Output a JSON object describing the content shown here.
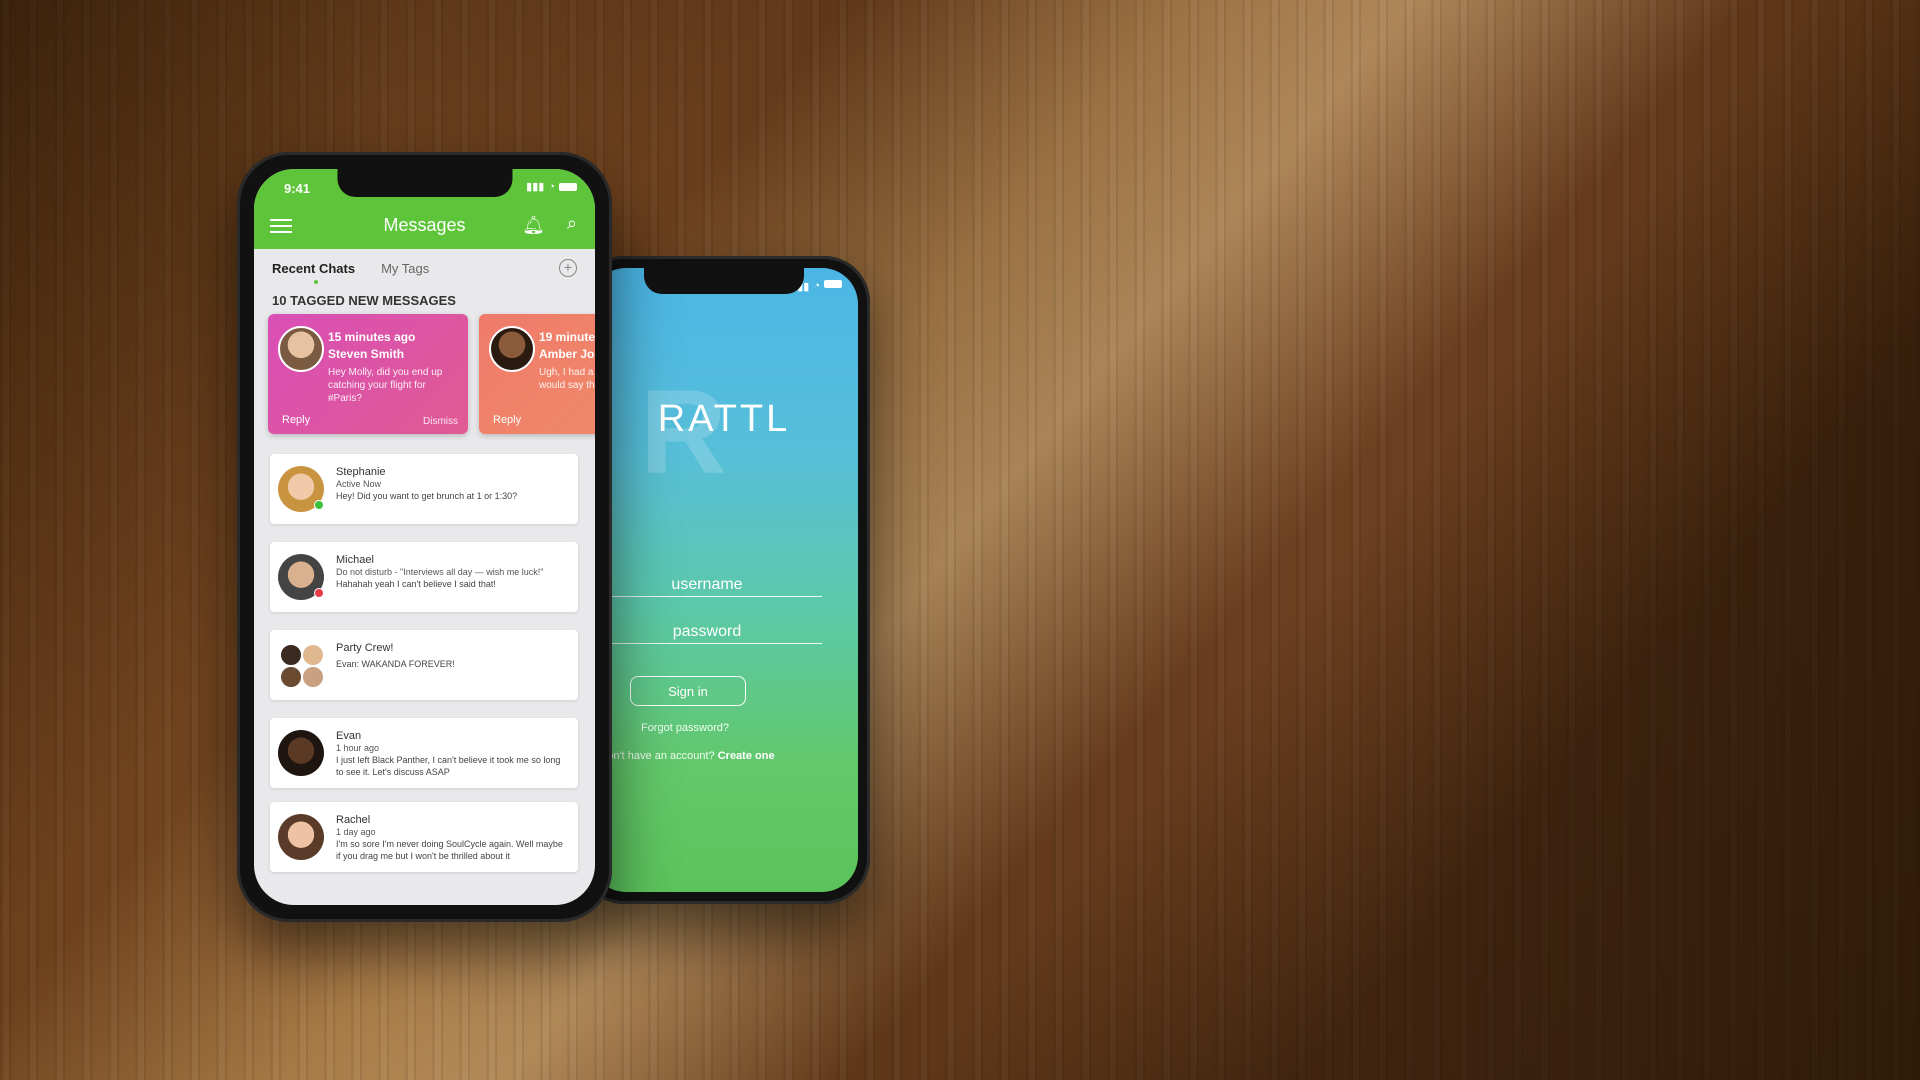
{
  "colors": {
    "accent": "#5ec53a",
    "tag_pink": "#d94fb6",
    "tag_orange": "#f07a6a",
    "online": "#3cc13c",
    "busy": "#e8394a"
  },
  "messages_app": {
    "status_time": "9:41",
    "header_title": "Messages",
    "icons": {
      "menu": "hamburger-icon",
      "bell": "bell-icon",
      "search": "search-icon",
      "add": "plus-circle-icon"
    },
    "tabs": [
      {
        "label": "Recent Chats",
        "active": true
      },
      {
        "label": "My Tags",
        "active": false
      }
    ],
    "section_label": "10 TAGGED NEW MESSAGES",
    "tagged": [
      {
        "time": "15 minutes ago",
        "name": "Steven Smith",
        "text": "Hey Molly, did you end up catching your flight for #Paris?",
        "reply": "Reply",
        "dismiss": "Dismiss"
      },
      {
        "time": "19 minute",
        "name": "Amber Jo",
        "text": "Ugh, I had a would say th",
        "reply": "Reply"
      }
    ],
    "chats": [
      {
        "name": "Stephanie",
        "sub": "Active Now",
        "msg": "Hey! Did you want to get brunch at 1 or 1:30?",
        "status": "online"
      },
      {
        "name": "Michael",
        "sub": "Do not disturb - \"Interviews all day — wish me luck!\"",
        "msg": "Hahahah yeah I can't believe I said that!",
        "status": "busy"
      },
      {
        "name": "Party Crew!",
        "sub": "",
        "msg": "Evan: WAKANDA FOREVER!",
        "status": ""
      },
      {
        "name": "Evan",
        "sub": "1 hour ago",
        "msg": "I just left Black Panther, I can't believe it took me so long to see it. Let's discuss ASAP",
        "status": ""
      },
      {
        "name": "Rachel",
        "sub": "1 day ago",
        "msg": "I'm so sore I'm never doing SoulCycle again. Well maybe if you drag me but I won't be thrilled about it",
        "status": ""
      }
    ]
  },
  "login_app": {
    "logo": "RATTL",
    "username_placeholder": "username",
    "password_placeholder": "password",
    "signin_label": "Sign in",
    "forgot_label": "Forgot password?",
    "no_account_text": "Don't have an account?",
    "create_label": "Create one"
  }
}
